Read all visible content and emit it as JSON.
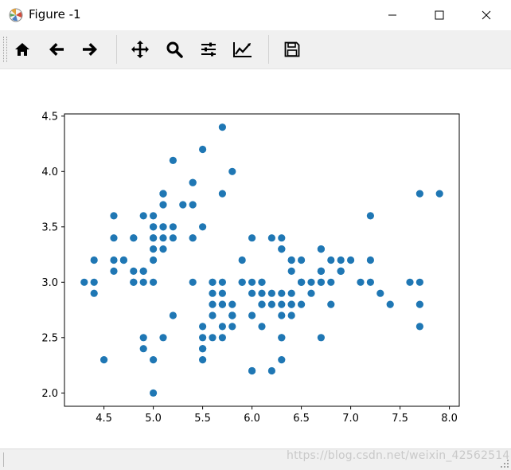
{
  "window": {
    "title": "Figure -1",
    "app_icon": "matplotlib-icon"
  },
  "window_controls": [
    "minimize-icon",
    "maximize-icon",
    "close-icon"
  ],
  "toolbar": {
    "tools": [
      "home-icon",
      "back-arrow-icon",
      "forward-arrow-icon",
      "pan-icon",
      "zoom-icon",
      "subplots-icon",
      "edit-axes-icon",
      "save-icon"
    ]
  },
  "colors": {
    "marker": "#1f77b4",
    "toolbar_bg": "#f0f0f0"
  },
  "chart_data": {
    "type": "scatter",
    "xlim": [
      4.1,
      8.1
    ],
    "ylim": [
      1.88,
      4.52
    ],
    "xticks": [
      4.5,
      5.0,
      5.5,
      6.0,
      6.5,
      7.0,
      7.5,
      8.0
    ],
    "xtick_labels": [
      "4.5",
      "5.0",
      "5.5",
      "6.0",
      "6.5",
      "7.0",
      "7.5",
      "8.0"
    ],
    "yticks": [
      2.0,
      2.5,
      3.0,
      3.5,
      4.0,
      4.5
    ],
    "ytick_labels": [
      "2.0",
      "2.5",
      "3.0",
      "3.5",
      "4.0",
      "4.5"
    ],
    "grid": false,
    "points": [
      [
        5.1,
        3.5
      ],
      [
        4.9,
        3.0
      ],
      [
        4.7,
        3.2
      ],
      [
        4.6,
        3.1
      ],
      [
        5.0,
        3.6
      ],
      [
        5.4,
        3.9
      ],
      [
        4.6,
        3.4
      ],
      [
        5.0,
        3.4
      ],
      [
        4.4,
        2.9
      ],
      [
        4.9,
        3.1
      ],
      [
        5.4,
        3.7
      ],
      [
        4.8,
        3.4
      ],
      [
        4.8,
        3.0
      ],
      [
        4.3,
        3.0
      ],
      [
        5.8,
        4.0
      ],
      [
        5.7,
        4.4
      ],
      [
        5.4,
        3.9
      ],
      [
        5.1,
        3.5
      ],
      [
        5.7,
        3.8
      ],
      [
        5.1,
        3.8
      ],
      [
        5.4,
        3.4
      ],
      [
        5.1,
        3.7
      ],
      [
        4.6,
        3.6
      ],
      [
        5.1,
        3.3
      ],
      [
        4.8,
        3.4
      ],
      [
        5.0,
        3.0
      ],
      [
        5.0,
        3.4
      ],
      [
        5.2,
        3.5
      ],
      [
        5.2,
        3.4
      ],
      [
        4.7,
        3.2
      ],
      [
        4.8,
        3.1
      ],
      [
        5.4,
        3.4
      ],
      [
        5.2,
        4.1
      ],
      [
        5.5,
        4.2
      ],
      [
        4.9,
        3.1
      ],
      [
        5.0,
        3.2
      ],
      [
        5.5,
        3.5
      ],
      [
        4.9,
        3.6
      ],
      [
        4.4,
        3.0
      ],
      [
        5.1,
        3.4
      ],
      [
        5.0,
        3.5
      ],
      [
        4.5,
        2.3
      ],
      [
        4.4,
        3.2
      ],
      [
        5.0,
        3.5
      ],
      [
        5.1,
        3.8
      ],
      [
        4.8,
        3.0
      ],
      [
        5.1,
        3.8
      ],
      [
        4.6,
        3.2
      ],
      [
        5.3,
        3.7
      ],
      [
        5.0,
        3.3
      ],
      [
        7.0,
        3.2
      ],
      [
        6.4,
        3.2
      ],
      [
        6.9,
        3.1
      ],
      [
        5.5,
        2.3
      ],
      [
        6.5,
        2.8
      ],
      [
        5.7,
        2.8
      ],
      [
        6.3,
        3.3
      ],
      [
        4.9,
        2.4
      ],
      [
        6.6,
        2.9
      ],
      [
        5.2,
        2.7
      ],
      [
        5.0,
        2.0
      ],
      [
        5.9,
        3.0
      ],
      [
        6.0,
        2.2
      ],
      [
        6.1,
        2.9
      ],
      [
        5.6,
        2.9
      ],
      [
        6.7,
        3.1
      ],
      [
        5.6,
        3.0
      ],
      [
        5.8,
        2.7
      ],
      [
        6.2,
        2.2
      ],
      [
        5.6,
        2.5
      ],
      [
        5.9,
        3.2
      ],
      [
        6.1,
        2.8
      ],
      [
        6.3,
        2.5
      ],
      [
        6.1,
        2.8
      ],
      [
        6.4,
        2.9
      ],
      [
        6.6,
        3.0
      ],
      [
        6.8,
        2.8
      ],
      [
        6.7,
        3.0
      ],
      [
        6.0,
        2.9
      ],
      [
        5.7,
        2.6
      ],
      [
        5.5,
        2.4
      ],
      [
        5.5,
        2.4
      ],
      [
        5.8,
        2.7
      ],
      [
        6.0,
        2.7
      ],
      [
        5.4,
        3.0
      ],
      [
        6.0,
        3.4
      ],
      [
        6.7,
        3.1
      ],
      [
        6.3,
        2.3
      ],
      [
        5.6,
        3.0
      ],
      [
        5.5,
        2.5
      ],
      [
        5.5,
        2.6
      ],
      [
        6.1,
        3.0
      ],
      [
        5.8,
        2.6
      ],
      [
        5.0,
        2.3
      ],
      [
        5.6,
        2.7
      ],
      [
        5.7,
        3.0
      ],
      [
        5.7,
        2.9
      ],
      [
        6.2,
        2.9
      ],
      [
        5.1,
        2.5
      ],
      [
        5.7,
        2.8
      ],
      [
        6.3,
        3.3
      ],
      [
        5.8,
        2.7
      ],
      [
        7.1,
        3.0
      ],
      [
        6.3,
        2.9
      ],
      [
        6.5,
        3.0
      ],
      [
        7.6,
        3.0
      ],
      [
        4.9,
        2.5
      ],
      [
        7.3,
        2.9
      ],
      [
        6.7,
        2.5
      ],
      [
        7.2,
        3.6
      ],
      [
        6.5,
        3.2
      ],
      [
        6.4,
        2.7
      ],
      [
        6.8,
        3.0
      ],
      [
        5.7,
        2.5
      ],
      [
        5.8,
        2.8
      ],
      [
        6.4,
        3.2
      ],
      [
        6.5,
        3.0
      ],
      [
        7.7,
        3.8
      ],
      [
        7.7,
        2.6
      ],
      [
        6.0,
        2.2
      ],
      [
        6.9,
        3.2
      ],
      [
        5.6,
        2.8
      ],
      [
        7.7,
        2.8
      ],
      [
        6.3,
        2.7
      ],
      [
        6.7,
        3.3
      ],
      [
        7.2,
        3.2
      ],
      [
        6.2,
        2.8
      ],
      [
        6.1,
        3.0
      ],
      [
        6.4,
        2.8
      ],
      [
        7.2,
        3.0
      ],
      [
        7.4,
        2.8
      ],
      [
        7.9,
        3.8
      ],
      [
        6.4,
        2.8
      ],
      [
        6.3,
        2.8
      ],
      [
        6.1,
        2.6
      ],
      [
        7.7,
        3.0
      ],
      [
        6.3,
        3.4
      ],
      [
        6.4,
        3.1
      ],
      [
        6.0,
        3.0
      ],
      [
        6.9,
        3.1
      ],
      [
        6.7,
        3.1
      ],
      [
        6.9,
        3.1
      ],
      [
        5.8,
        2.7
      ],
      [
        6.8,
        3.2
      ],
      [
        6.7,
        3.3
      ],
      [
        6.7,
        3.0
      ],
      [
        6.3,
        2.5
      ],
      [
        6.5,
        3.0
      ],
      [
        6.2,
        3.4
      ],
      [
        5.9,
        3.0
      ]
    ]
  },
  "statusbar": {
    "watermark": "https://blog.csdn.net/weixin_42562514"
  }
}
